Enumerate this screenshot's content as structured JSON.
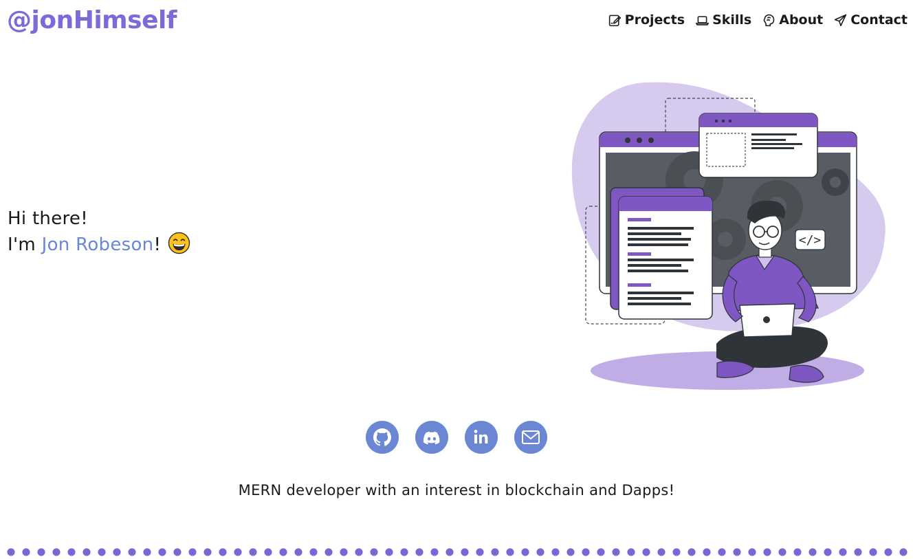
{
  "header": {
    "logo": "@jonHimself",
    "nav": [
      {
        "label": "Projects",
        "icon": "edit-document-icon"
      },
      {
        "label": "Skills",
        "icon": "laptop-icon"
      },
      {
        "label": "About",
        "icon": "brain-icon"
      },
      {
        "label": "Contact",
        "icon": "paper-plane-icon"
      }
    ]
  },
  "hero": {
    "greeting": "Hi there!",
    "intro_prefix": "I'm ",
    "name": "Jon Robeson",
    "intro_suffix": "!",
    "emoji": "grinning-face-emoji"
  },
  "illustration": {
    "code_tag": "</>"
  },
  "socials": [
    {
      "name": "github-icon"
    },
    {
      "name": "discord-icon"
    },
    {
      "name": "linkedin-icon"
    },
    {
      "name": "mail-icon"
    }
  ],
  "tagline": "MERN developer with an interest in blockchain and Dapps!",
  "colors": {
    "accent": "#7e69d8",
    "name": "#6b86d2",
    "social_bg": "#6b86d2",
    "dots": "#7b66d6"
  }
}
